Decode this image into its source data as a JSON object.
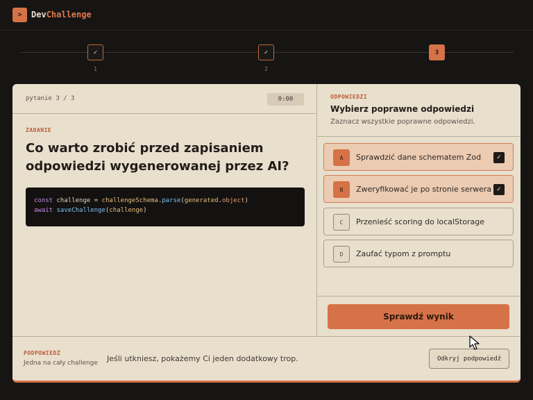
{
  "header": {
    "logo_icon": ">",
    "brand_part1": "Dev",
    "brand_part2": "Challenge"
  },
  "stepper": {
    "steps": [
      {
        "num": "1",
        "mark": "✓",
        "state": "done"
      },
      {
        "num": "2",
        "mark": "✓",
        "state": "done"
      },
      {
        "num": "3",
        "mark": "3",
        "state": "active"
      }
    ]
  },
  "question": {
    "counter": "pytanie 3 / 3",
    "timer": "0:00",
    "section_label": "ZADANIE",
    "text": "Co warto zrobić przed zapisaniem odpowiedzi wygenerowanej przez AI?",
    "code": {
      "line1": {
        "kw": "const",
        "var": "challenge",
        "eq": "=",
        "obj": "challengeSchema",
        "dot1": ".",
        "fn": "parse",
        "p1": "(",
        "arg1": "generated",
        "dot2": ".",
        "prop": "object",
        "p2": ")"
      },
      "line2": {
        "kw": "await",
        "fn": "saveChallenge",
        "p1": "(",
        "arg": "challenge",
        "p2": ")"
      }
    }
  },
  "answers": {
    "section_label": "ODPOWIEDZI",
    "title": "Wybierz poprawne odpowiedzi",
    "subtitle": "Zaznacz wszystkie poprawne odpowiedzi.",
    "options": [
      {
        "letter": "A",
        "text": "Sprawdzić dane schematem Zod",
        "selected": true,
        "check": "✓"
      },
      {
        "letter": "B",
        "text": "Zweryfikować je po stronie serwera",
        "selected": true,
        "check": "✓"
      },
      {
        "letter": "C",
        "text": "Przenieść scoring do localStorage",
        "selected": false
      },
      {
        "letter": "D",
        "text": "Zaufać typom z promptu",
        "selected": false
      }
    ],
    "submit_label": "Sprawdź wynik"
  },
  "hint": {
    "label": "PODPOWIEDŹ",
    "sub": "Jedna na cały challenge",
    "text": "Jeśli utkniesz, pokażemy Ci jeden dodatkowy trop.",
    "button": "Odkryj podpowiedź"
  },
  "colors": {
    "accent": "#d67247",
    "card_bg": "#e8dfcd",
    "page_bg": "#161514",
    "selected_bg": "#ebcbb2"
  }
}
